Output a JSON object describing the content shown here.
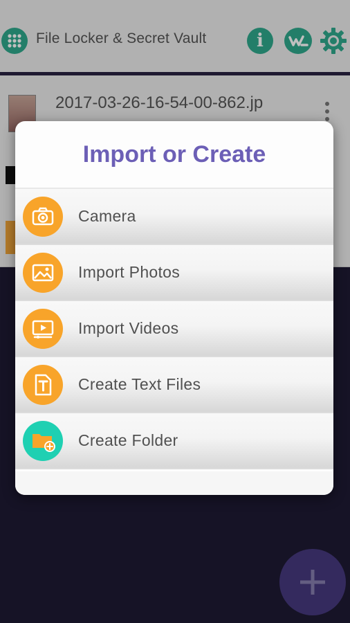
{
  "appbar": {
    "title": "File Locker & Secret Vault",
    "info_symbol": "i",
    "icons": [
      "apps-grid-icon",
      "info-icon",
      "brand-wl-icon",
      "settings-gear-icon"
    ],
    "accent": "#2fa98c"
  },
  "file_list": {
    "items": [
      {
        "name": "2017-03-26-16-54-00-862.jp"
      }
    ]
  },
  "dialog": {
    "title": "Import or Create",
    "title_color": "#6c5fb6",
    "items": [
      {
        "label": "Camera",
        "icon": "camera-icon",
        "color": "#f8a42a"
      },
      {
        "label": "Import Photos",
        "icon": "image-icon",
        "color": "#f8a42a"
      },
      {
        "label": "Import Videos",
        "icon": "video-icon",
        "color": "#f8a42a"
      },
      {
        "label": "Create Text Files",
        "icon": "text-file-icon",
        "color": "#f8a42a"
      },
      {
        "label": "Create Folder",
        "icon": "folder-add-icon",
        "color": "#1fd0b2"
      }
    ]
  },
  "fab": {
    "icon": "plus-icon",
    "color": "#4e3f8c"
  }
}
